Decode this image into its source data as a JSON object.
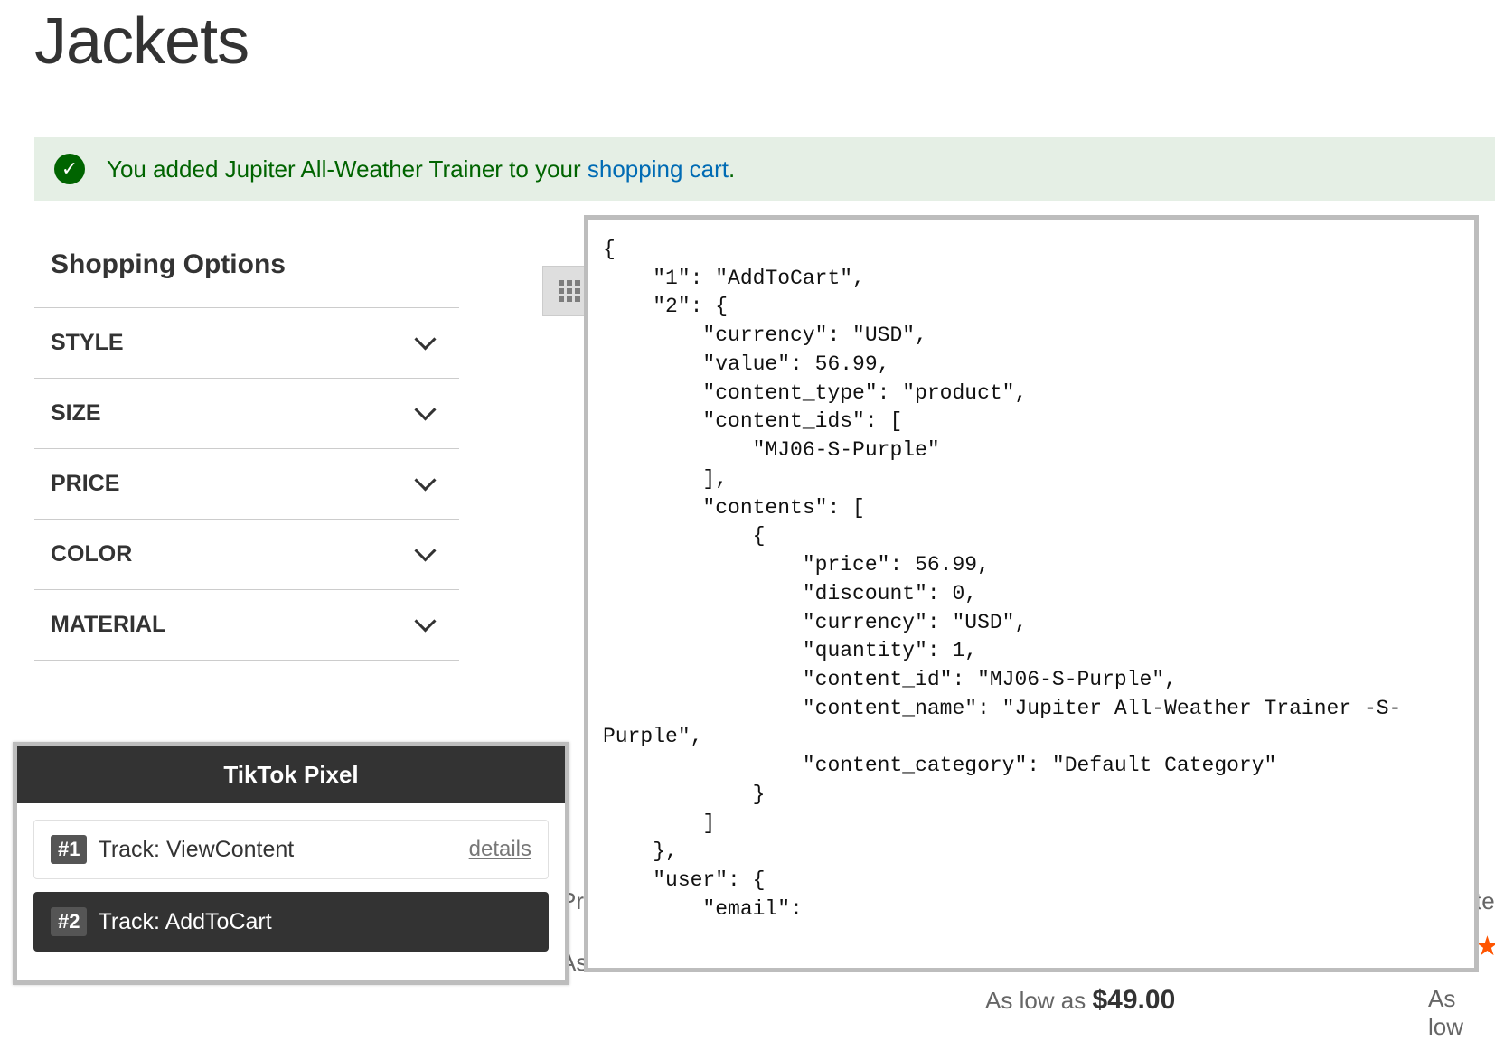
{
  "page": {
    "title": "Jackets"
  },
  "success": {
    "prefix": "You added Jupiter All-Weather Trainer to your ",
    "link_text": "shopping cart",
    "suffix": "."
  },
  "sidebar": {
    "title": "Shopping Options",
    "filters": [
      {
        "label": "STYLE"
      },
      {
        "label": "SIZE"
      },
      {
        "label": "PRICE"
      },
      {
        "label": "COLOR"
      },
      {
        "label": "MATERIAL"
      }
    ]
  },
  "pixel_panel": {
    "title": "TikTok Pixel",
    "events": [
      {
        "num": "#1",
        "label": "Track: ViewContent",
        "details": "details",
        "active": false
      },
      {
        "num": "#2",
        "label": "Track: AddToCart",
        "details": "",
        "active": true
      }
    ]
  },
  "code_panel": {
    "json_text": "{\n    \"1\": \"AddToCart\",\n    \"2\": {\n        \"currency\": \"USD\",\n        \"value\": 56.99,\n        \"content_type\": \"product\",\n        \"content_ids\": [\n            \"MJ06-S-Purple\"\n        ],\n        \"contents\": [\n            {\n                \"price\": 56.99,\n                \"discount\": 0,\n                \"currency\": \"USD\",\n                \"quantity\": 1,\n                \"content_id\": \"MJ06-S-Purple\",\n                \"content_name\": \"Jupiter All-Weather Trainer -S-Purple\",\n                \"content_category\": \"Default Category\"\n            }\n        ]\n    },\n    \"user\": {\n        \"email\":"
  },
  "behind": {
    "pro_fragment": "Pro",
    "as_l_fragment": "As l",
    "te_fragment": "te",
    "as_low_as": "As low as",
    "price": "$49.00",
    "as_low_fragment": "As low"
  }
}
